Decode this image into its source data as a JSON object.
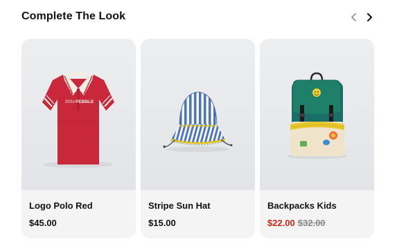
{
  "section": {
    "title": "Complete The Look",
    "prev_icon": "chevron-left-icon",
    "next_icon": "chevron-right-icon"
  },
  "products": [
    {
      "name": "Logo Polo Red",
      "price": "$45.00",
      "image_icon": "red-polo-shirt-image",
      "print_text": "PEBBLE"
    },
    {
      "name": "Stripe Sun Hat",
      "price": "$15.00",
      "image_icon": "striped-bucket-hat-image"
    },
    {
      "name": "Backpacks Kids",
      "sale_price": "$22.00",
      "original_price": "$32.00",
      "image_icon": "green-backpack-image"
    }
  ],
  "colors": {
    "sale": "#d0281c",
    "strikethrough": "#8a8a8a",
    "card_bg": "#f4f4f4",
    "image_bg": "#e7e9ec"
  }
}
